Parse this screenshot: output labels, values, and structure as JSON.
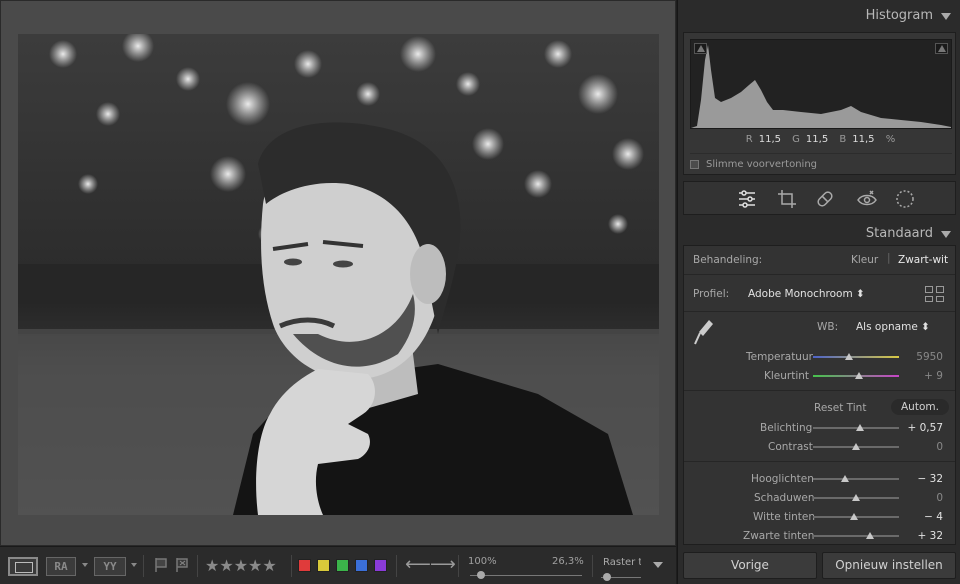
{
  "toolbar": {
    "view_compare": "RA",
    "view_survey": "YY",
    "stars": "★★★★★",
    "color_labels": [
      "#e03b3b",
      "#d8c93a",
      "#3bb44a",
      "#3b6fd8",
      "#8a3bd8"
    ],
    "zoom_min": "100%",
    "zoom_current": "26,3%",
    "zoom_level": 0.1,
    "raster_label": "Raster t",
    "raster_level": 0.15
  },
  "histogram": {
    "title": "Histogram",
    "r_label": "R",
    "r_value": "11,5",
    "g_label": "G",
    "g_value": "11,5",
    "b_label": "B",
    "b_value": "11,5",
    "percent": "%",
    "smart_preview": "Slimme voorvertoning"
  },
  "tools": [
    "sliders-icon",
    "crop-icon",
    "healing-icon",
    "redeye-icon",
    "mask-icon"
  ],
  "basic": {
    "title": "Standaard",
    "treatment_label": "Behandeling:",
    "treatment_color": "Kleur",
    "treatment_bw": "Zwart-wit",
    "profile_label": "Profiel:",
    "profile_value": "Adobe Monochroom ⬍",
    "wb_label": "WB:",
    "wb_value": "Als opname ⬍",
    "temp_label": "Temperatuur",
    "temp_value": "5950",
    "temp_level": 0.42,
    "tint_label": "Kleurtint",
    "tint_value": "+ 9",
    "tint_level": 0.53,
    "reset_label": "Reset Tint",
    "auto_label": "Autom.",
    "exposure_label": "Belichting",
    "exposure_value": "+ 0,57",
    "exposure_level": 0.55,
    "contrast_label": "Contrast",
    "contrast_value": "0",
    "contrast_level": 0.5,
    "highlights_label": "Hooglichten",
    "highlights_value": "− 32",
    "highlights_level": 0.37,
    "shadows_label": "Schaduwen",
    "shadows_value": "0",
    "shadows_level": 0.5,
    "whites_label": "Witte tinten",
    "whites_value": "− 4",
    "whites_level": 0.48,
    "blacks_label": "Zwarte tinten",
    "blacks_value": "+ 32",
    "blacks_level": 0.66
  },
  "buttons": {
    "previous": "Vorige",
    "reset": "Opnieuw instellen"
  }
}
